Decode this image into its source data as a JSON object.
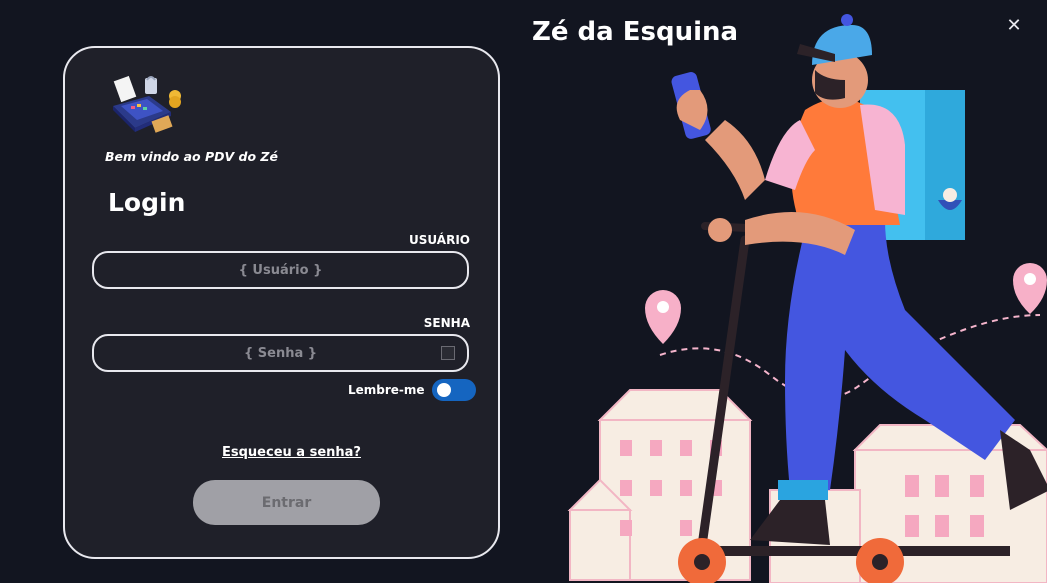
{
  "window": {
    "close_icon": "close-icon"
  },
  "app": {
    "title": "Zé da Esquina"
  },
  "login": {
    "welcome": "Bem vindo ao PDV do Zé",
    "title": "Login",
    "user_label": "USUÁRIO",
    "user_placeholder": "{ Usuário }",
    "user_value": "",
    "password_label": "SENHA",
    "password_placeholder": "{ Senha }",
    "password_value": "",
    "remember_label": "Lembre-me",
    "remember_on": true,
    "forgot_link": "Esqueceu a senha?",
    "enter_button": "Entrar"
  },
  "colors": {
    "background": "#121520",
    "panel": "#1f2029",
    "toggle_on": "#1565c0",
    "button_disabled": "#a0a0a6"
  }
}
